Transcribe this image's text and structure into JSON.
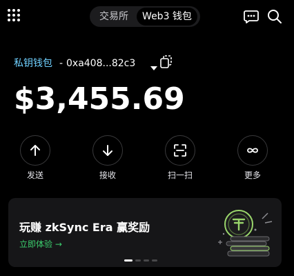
{
  "header": {
    "tabs": [
      {
        "label": "交易所",
        "active": false
      },
      {
        "label": "Web3 钱包",
        "active": true
      }
    ],
    "icons": {
      "grid": "grid-dots-icon",
      "chat": "chat-bubble-icon",
      "search": "search-icon"
    }
  },
  "wallet": {
    "name": "私钥钱包",
    "separator": "-",
    "address": "0xa408...82c3",
    "balance": "$3,455.69",
    "accent_color": "#6fd0ff"
  },
  "actions": [
    {
      "label": "发送",
      "icon": "arrow-up-icon"
    },
    {
      "label": "接收",
      "icon": "arrow-down-icon"
    },
    {
      "label": "扫一扫",
      "icon": "scan-icon"
    },
    {
      "label": "更多",
      "icon": "infinity-icon"
    }
  ],
  "promo": {
    "title": "玩赚 zkSync Era 赢奖励",
    "link": "立即体验 →",
    "link_color": "#3ccf6e",
    "pages": 4,
    "active_page": 0
  }
}
